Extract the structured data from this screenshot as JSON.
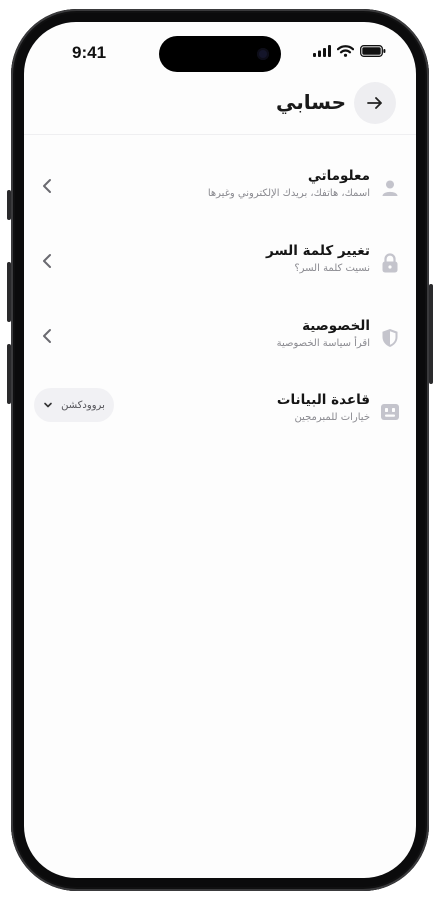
{
  "status_bar": {
    "time": "9:41"
  },
  "header": {
    "title": "حسابي"
  },
  "menu": [
    {
      "title": "معلوماتي",
      "subtitle": "اسمك، هاتفك، بريدك الإلكتروني وغيرها",
      "icon": "person-icon"
    },
    {
      "title": "تغيير كلمة السر",
      "subtitle": "نسيت كلمة السر؟",
      "icon": "lock-icon"
    },
    {
      "title": "الخصوصية",
      "subtitle": "اقرأ سياسة الخصوصية",
      "icon": "shield-icon"
    },
    {
      "title": "قاعدة البيانات",
      "subtitle": "خيارات للمبرمجين",
      "icon": "database-icon",
      "select_value": "بروودكشن"
    }
  ],
  "colors": {
    "icon_gray": "#c4c4cc",
    "back_button_bg": "#eeeef1",
    "select_bg": "#f1f1f4"
  }
}
